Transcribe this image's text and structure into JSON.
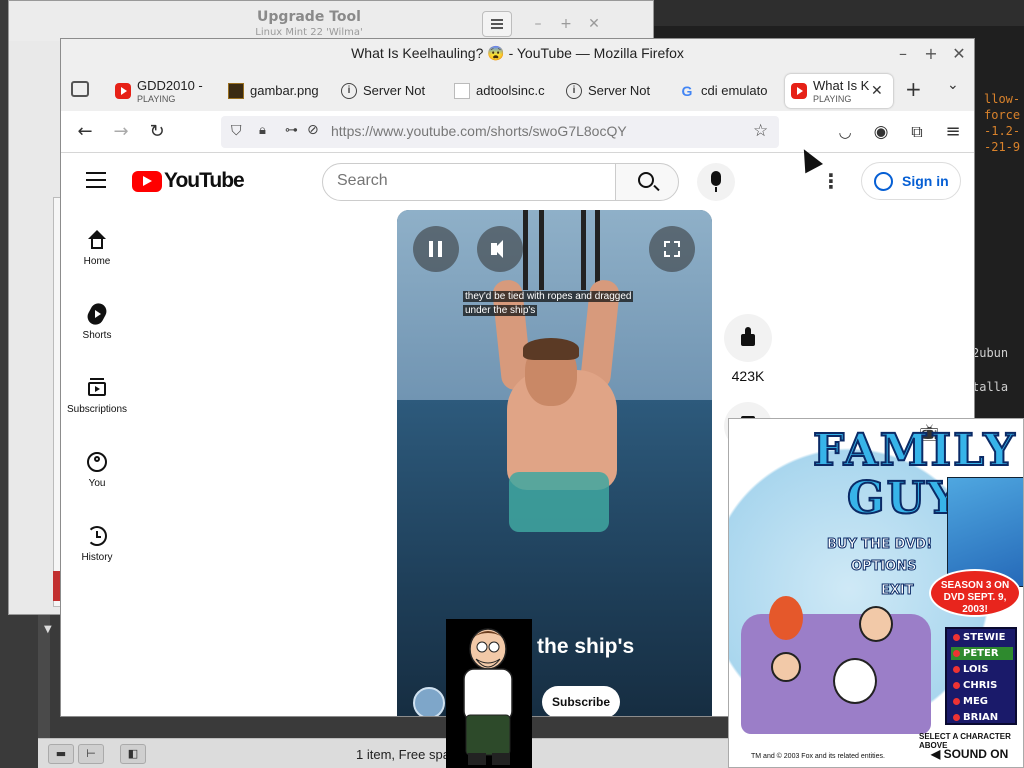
{
  "desktop": {
    "upgrade_tool": {
      "title": "Upgrade Tool",
      "subtitle": "Linux Mint 22 'Wilma'"
    },
    "terminal": {
      "lines": [
        "llow-",
        "force",
        "-1.2-",
        "-21-9",
        "2ubun",
        "talla"
      ]
    },
    "files": {
      "status": "1 item, Free spa"
    }
  },
  "firefox": {
    "window_title": "What Is Keelhauling? 😨 - YouTube — Mozilla Firefox",
    "tabs": [
      {
        "label": "GDD2010 - ",
        "sub": "PLAYING",
        "icon": "youtube-icon"
      },
      {
        "label": "gambar.png",
        "icon": "image-icon"
      },
      {
        "label": "Server Not ",
        "icon": "info-icon"
      },
      {
        "label": "adtoolsinc.c",
        "icon": "blank-page-icon"
      },
      {
        "label": "Server Not ",
        "icon": "info-icon"
      },
      {
        "label": "cdi emulato",
        "icon": "google-icon"
      },
      {
        "label": "What Is K",
        "sub": "PLAYING",
        "icon": "youtube-icon",
        "active": true
      }
    ],
    "url": "https://www.youtube.com/shorts/swoG7L8ocQY"
  },
  "youtube": {
    "logo_text": "YouTube",
    "search_placeholder": "Search",
    "signin_label": "Sign in",
    "sidebar": [
      {
        "label": "Home",
        "icon": "home-icon"
      },
      {
        "label": "Shorts",
        "icon": "shorts-icon"
      },
      {
        "label": "Subscriptions",
        "icon": "subscriptions-icon"
      },
      {
        "label": "You",
        "icon": "user-icon"
      },
      {
        "label": "History",
        "icon": "history-icon"
      }
    ],
    "video": {
      "caption_line1": "they'd be tied with ropes and dragged",
      "caption_line2": "under the ship's",
      "big_caption": "the ship's",
      "subscribe_label": "Subscribe"
    },
    "actions": {
      "like_count": "423K"
    }
  },
  "family_guy_ad": {
    "title_line1": "FAMILY",
    "title_line2": "GUY",
    "menu": [
      "BUY THE DVD!",
      "OPTIONS",
      "EXIT"
    ],
    "season_badge": "SEASON 3 ON DVD SEPT. 9, 2003!",
    "characters": [
      "STEWIE",
      "PETER",
      "LOIS",
      "CHRIS",
      "MEG",
      "BRIAN"
    ],
    "select_hint": "SELECT A CHARACTER ABOVE",
    "copyright": "TM and © 2003 Fox and its related entities.",
    "sound": "SOUND ON"
  },
  "colors": {
    "youtube_red": "#ff0000",
    "signin_blue": "#065fd4",
    "terminal_orange": "#d9822b"
  }
}
